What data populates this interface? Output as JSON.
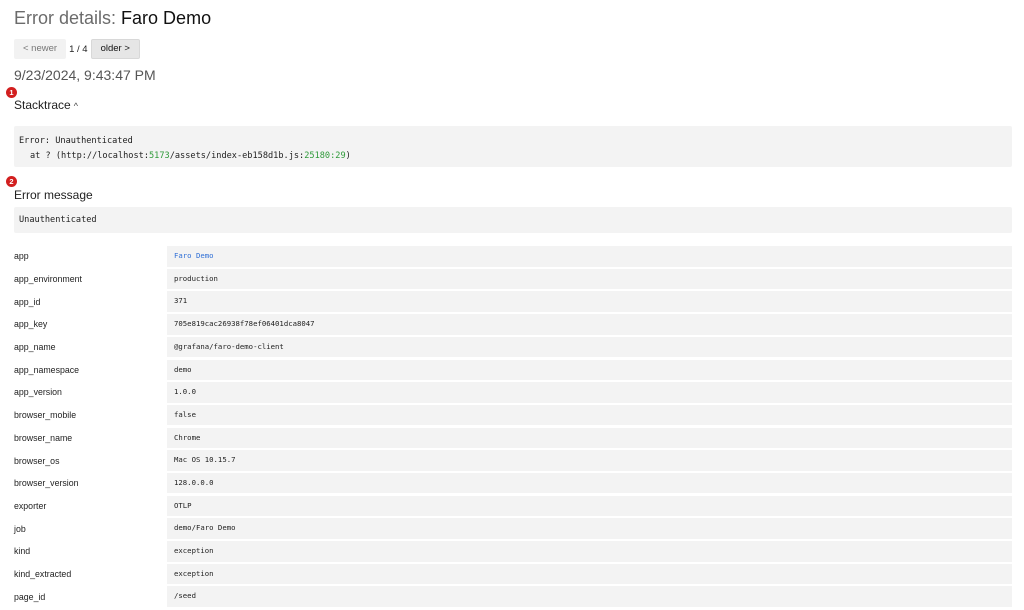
{
  "header": {
    "title_prefix": "Error details: ",
    "title_name": "Faro Demo"
  },
  "pager": {
    "newer_label": "< newer",
    "count": "1 / 4",
    "older_label": "older >"
  },
  "timestamp": "9/23/2024, 9:43:47 PM",
  "markers": [
    "1",
    "2"
  ],
  "stacktrace": {
    "title": "Stacktrace",
    "caret": "^",
    "line1": "Error: Unauthenticated",
    "line2_prefix": "at ? (http://localhost:",
    "port": "5173",
    "line2_path": "/assets/index-eb158d1b.js:",
    "line_col": "25180:29",
    "line2_suffix": ")"
  },
  "error_message": {
    "title": "Error message",
    "value": "Unauthenticated"
  },
  "attributes": [
    {
      "key": "app",
      "value": "Faro Demo",
      "link": true
    },
    {
      "key": "app_environment",
      "value": "production"
    },
    {
      "key": "app_id",
      "value": "371"
    },
    {
      "key": "app_key",
      "value": "705e819cac26938f78ef06401dca8047"
    },
    {
      "key": "app_name",
      "value": "@grafana/faro-demo-client"
    },
    {
      "key": "app_namespace",
      "value": "demo"
    },
    {
      "key": "app_version",
      "value": "1.0.0"
    },
    {
      "key": "browser_mobile",
      "value": "false"
    },
    {
      "key": "browser_name",
      "value": "Chrome"
    },
    {
      "key": "browser_os",
      "value": "Mac OS 10.15.7"
    },
    {
      "key": "browser_version",
      "value": "128.0.0.0"
    },
    {
      "key": "exporter",
      "value": "OTLP"
    },
    {
      "key": "job",
      "value": "demo/Faro Demo"
    },
    {
      "key": "kind",
      "value": "exception"
    },
    {
      "key": "kind_extracted",
      "value": "exception"
    },
    {
      "key": "page_id",
      "value": "/seed"
    }
  ]
}
